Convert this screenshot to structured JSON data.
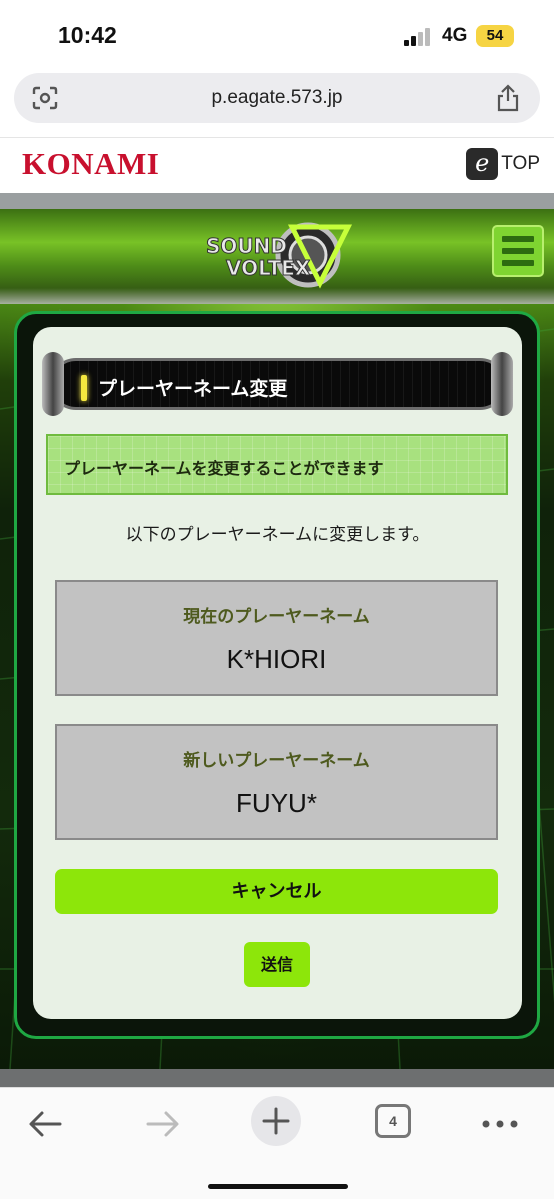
{
  "status_bar": {
    "time": "10:42",
    "network": "4G",
    "battery": "54"
  },
  "browser": {
    "url": "p.eagate.573.jp",
    "tab_count": "4",
    "icons": {
      "scan": "screenshot-scan-icon",
      "share": "share-icon",
      "back": "back-arrow-icon",
      "forward": "forward-arrow-icon",
      "new_tab": "plus-icon",
      "more": "more-dots-icon"
    }
  },
  "site_header": {
    "brand": "KONAMI",
    "top_link": "TOP",
    "eicon": "e"
  },
  "game": {
    "logo_line1": "SOUND",
    "logo_line2": "VOLTEX",
    "menu_icon": "hamburger-menu-icon"
  },
  "panel": {
    "title": "プレーヤーネーム変更",
    "notice": "プレーヤーネームを変更することができます",
    "description": "以下のプレーヤーネームに変更します。",
    "current": {
      "label": "現在のプレーヤーネーム",
      "value": "K*HIORI"
    },
    "new": {
      "label": "新しいプレーヤーネーム",
      "value": "FUYU*"
    },
    "cancel_label": "キャンセル",
    "send_label": "送信"
  },
  "colors": {
    "konami_red": "#c8102e",
    "accent_green": "#8de60a",
    "frame_green": "#1fa843",
    "panel_bg": "#e8f1e5"
  }
}
